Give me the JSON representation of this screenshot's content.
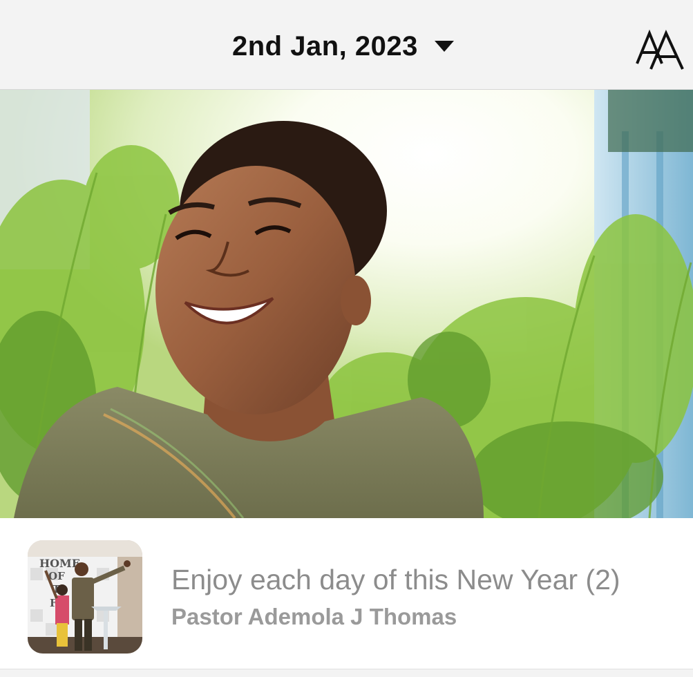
{
  "header": {
    "date_label": "2nd Jan, 2023",
    "date_dropdown_icon": "caret-down-icon",
    "font_size_icon": "text-size-icon"
  },
  "hero": {
    "image": "smiling-woman-in-sunlight-photo"
  },
  "devotional": {
    "title": "Enjoy each day of this New Year (2)",
    "author": "Pastor Ademola J Thomas",
    "thumbnail": "pastor-preaching-at-pulpit-photo",
    "thumbnail_wall_text": [
      "HOME",
      "OF",
      "T",
      "FI"
    ]
  },
  "colors": {
    "header_bg": "#f3f3f3",
    "title_text": "#8c8c8c",
    "date_text": "#111111"
  }
}
